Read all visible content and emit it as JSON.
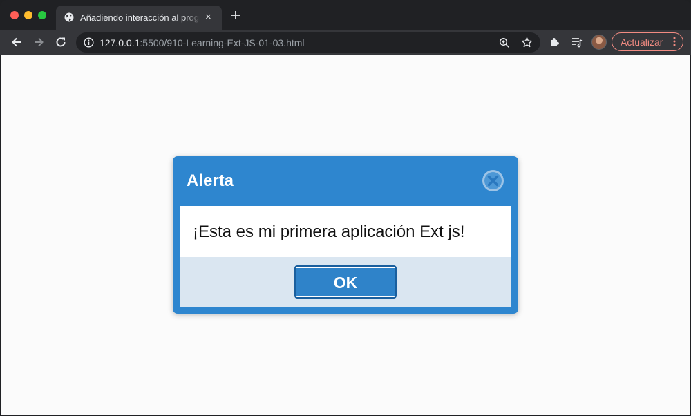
{
  "browser": {
    "tab": {
      "title": "Añadiendo interacción al programa",
      "close_icon": "×",
      "favicon": "globe-icon"
    },
    "new_tab_icon": "plus-icon",
    "address": {
      "host": "127.0.0.1",
      "path": ":5500/910-Learning-Ext-JS-01-03.html"
    },
    "update_button": {
      "label": "Actualizar",
      "color": "#f28b82"
    }
  },
  "page": {
    "background": "#fbfbfb"
  },
  "dialog": {
    "title": "Alerta",
    "message": "¡Esta es mi primera aplicación Ext js!",
    "ok_label": "OK",
    "colors": {
      "frame": "#2e86cf",
      "footer": "#dae6f1",
      "button": "#2f83c9"
    }
  }
}
